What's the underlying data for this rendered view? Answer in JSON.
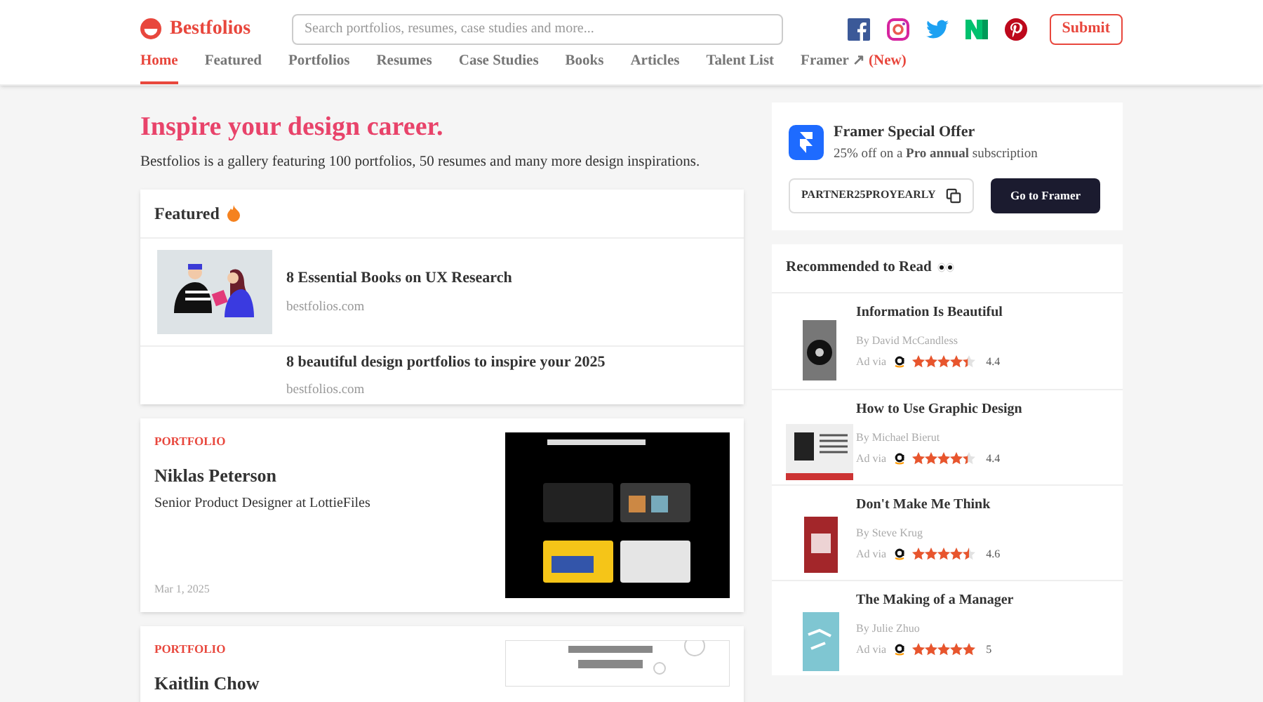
{
  "header": {
    "logo": "Bestfolios",
    "search": {
      "placeholder": "Search portfolios, resumes, case studies and more..."
    },
    "submit": "Submit"
  },
  "nav": [
    {
      "label": "Home",
      "selected": true
    },
    {
      "label": "Featured",
      "selected": false
    },
    {
      "label": "Portfolios",
      "selected": false
    },
    {
      "label": "Resumes",
      "selected": false
    },
    {
      "label": "Case Studies",
      "selected": false
    },
    {
      "label": "Books",
      "selected": false
    },
    {
      "label": "Articles",
      "selected": false
    },
    {
      "label": "Talent List",
      "selected": false
    },
    {
      "label": "Framer ↗",
      "selected": false,
      "badge": "(New)"
    }
  ],
  "hero": {
    "title": "Inspire your design career.",
    "text": "Bestfolios is a gallery featuring 100 portfolios, 50 resumes and many more design inspirations."
  },
  "featured": {
    "title": "Featured",
    "items": [
      {
        "title": "8 Essential Books on UX Research",
        "source": "bestfolios.com",
        "picture": true
      },
      {
        "title": "8 beautiful design portfolios to inspire your 2025",
        "source": "bestfolios.com",
        "picture": false
      }
    ]
  },
  "posts": [
    {
      "tag": "PORTFOLIO",
      "name": "Niklas Peterson",
      "role": "Senior Product Designer at LottieFiles",
      "date": "Mar 1, 2025",
      "kind": "dark"
    },
    {
      "tag": "PORTFOLIO",
      "name": "Kaitlin Chow",
      "kind": "light"
    }
  ],
  "offer": {
    "title": "Framer Special Offer",
    "text": "25% off on a **Pro annual** subscription",
    "code": "PARTNER25PROYEARLY",
    "button": "Go to Framer"
  },
  "recommended": {
    "title": "Recommended to Read",
    "books": [
      {
        "title": "Information Is Beautiful",
        "author": "By David McCandless",
        "ad": "Ad via",
        "stars": 4.4,
        "rating": "4.4",
        "kind": "grey"
      },
      {
        "title": "How to Use Graphic Design",
        "author": "By Michael Bierut",
        "ad": "Ad via",
        "stars": 4.4,
        "rating": "4.4",
        "kind": "white"
      },
      {
        "title": "Don't Make Me Think",
        "author": "By Steve Krug",
        "ad": "Ad via",
        "stars": 4.5,
        "rating": "4.6",
        "kind": "red"
      },
      {
        "title": "The Making of a Manager",
        "author": "By Julie Zhuo",
        "ad": "Ad via",
        "stars": 5,
        "rating": "5",
        "kind": "teal"
      }
    ]
  }
}
